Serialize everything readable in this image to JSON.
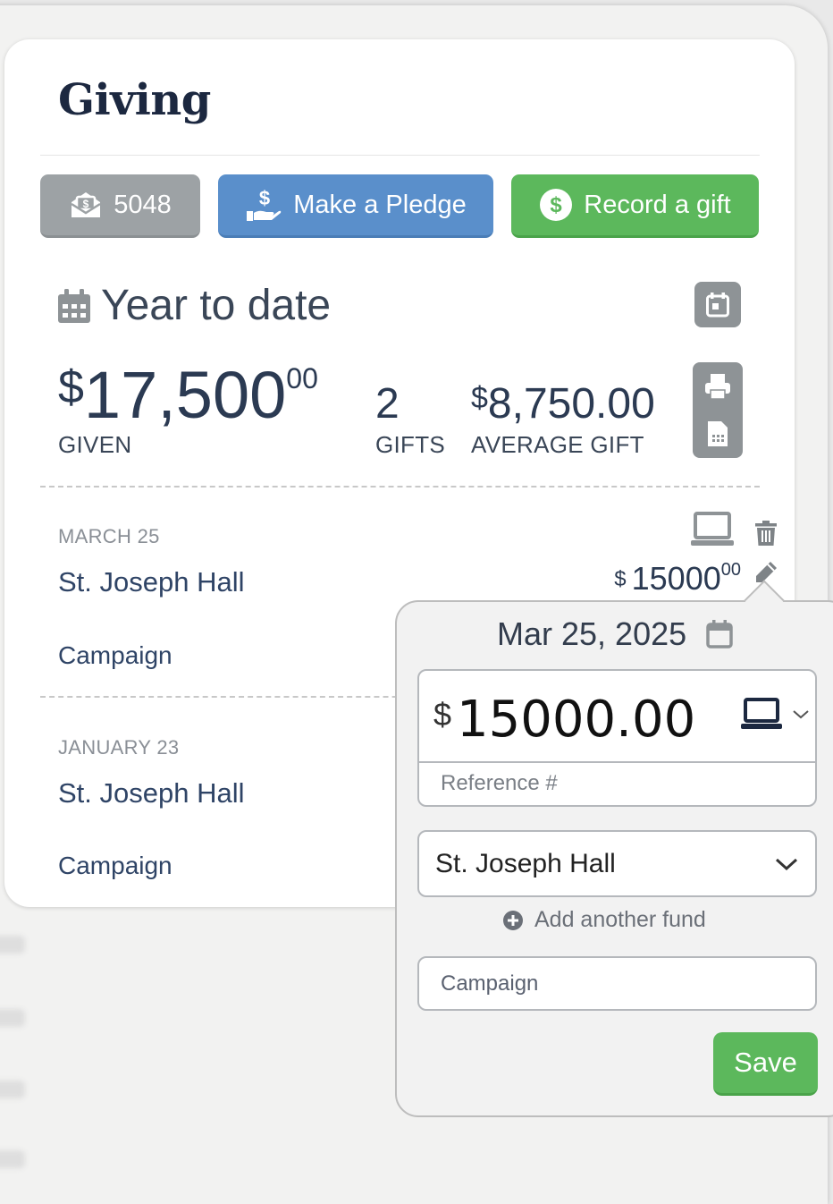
{
  "card": {
    "title": "Giving"
  },
  "actions": {
    "count": "5048",
    "pledge_label": "Make a Pledge",
    "record_label": "Record a gift"
  },
  "summary": {
    "heading": "Year to date",
    "given": {
      "currency": "$",
      "amount": "17,500",
      "cents": "00",
      "label": "GIVEN"
    },
    "gifts": {
      "count": "2",
      "label": "GIFTS"
    },
    "average": {
      "currency": "$",
      "amount": "8,750.00",
      "label": "AVERAGE GIFT"
    }
  },
  "gifts": [
    {
      "date": "MARCH 25",
      "fund": "St. Joseph Hall",
      "campaign": "Campaign",
      "currency": "$",
      "amount": "15000",
      "cents": "00"
    },
    {
      "date": "JANUARY 23",
      "fund": "St. Joseph Hall",
      "campaign": "Campaign"
    }
  ],
  "editor": {
    "date": "Mar 25, 2025",
    "currency": "$",
    "amount": "15000.00",
    "reference_placeholder": "Reference #",
    "fund": "St. Joseph Hall",
    "add_fund_label": "Add another fund",
    "campaign_placeholder": "Campaign",
    "save_label": "Save"
  },
  "colors": {
    "primary_blue": "#5a8fcb",
    "success_green": "#5cb85c",
    "neutral_gray": "#9da2a5",
    "text_navy": "#1c2840"
  },
  "icons": [
    "envelope-dollar-icon",
    "hand-dollar-icon",
    "dollar-circle-icon",
    "calendar-icon",
    "calendar-day-icon",
    "printer-icon",
    "file-icon",
    "laptop-icon",
    "trash-icon",
    "pencil-icon",
    "chevron-down-icon",
    "plus-circle-icon"
  ]
}
